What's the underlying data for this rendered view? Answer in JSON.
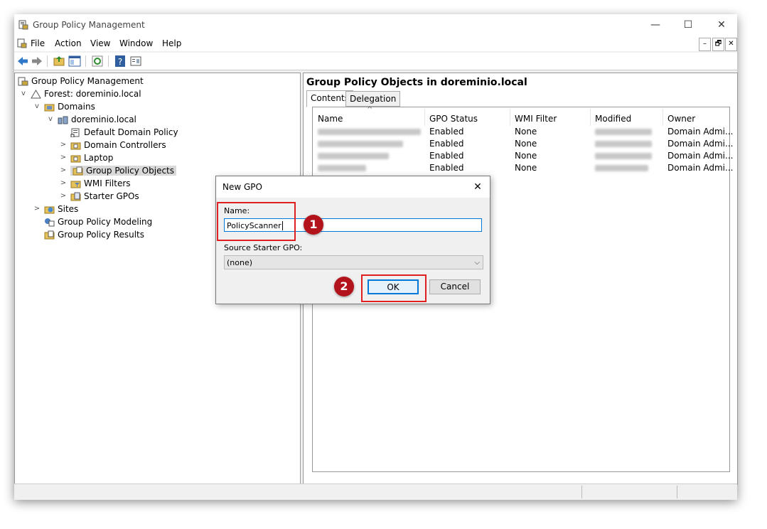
{
  "window": {
    "title": "Group Policy Management",
    "controls": [
      "—",
      "☐",
      "✕"
    ]
  },
  "menu": {
    "items": [
      "File",
      "Action",
      "View",
      "Window",
      "Help"
    ],
    "mdi": [
      "–",
      "🗗",
      "✕"
    ]
  },
  "toolbar": {
    "icons": [
      "back-icon",
      "forward-icon",
      "up-folder-icon",
      "show-hide-tree-icon",
      "refresh-icon",
      "help-icon",
      "properties-icon"
    ]
  },
  "tree": {
    "root": "Group Policy Management",
    "forest": "Forest: doreminio.local",
    "domains": "Domains",
    "domain": "doreminio.local",
    "default_policy": "Default Domain Policy",
    "domain_controllers": "Domain Controllers",
    "laptop": "Laptop",
    "gpo": "Group Policy Objects",
    "wmi": "WMI Filters",
    "starter": "Starter GPOs",
    "sites": "Sites",
    "modeling": "Group Policy Modeling",
    "results": "Group Policy Results"
  },
  "right": {
    "heading": "Group Policy Objects in doreminio.local",
    "tabs": [
      "Contents",
      "Delegation"
    ],
    "columns": [
      "Name",
      "GPO Status",
      "WMI Filter",
      "Modified",
      "Owner"
    ],
    "rows": [
      {
        "status": "Enabled",
        "wmi": "None",
        "owner": "Domain Admi..."
      },
      {
        "status": "Enabled",
        "wmi": "None",
        "owner": "Domain Admi..."
      },
      {
        "status": "Enabled",
        "wmi": "None",
        "owner": "Domain Admi..."
      },
      {
        "status": "Enabled",
        "wmi": "None",
        "owner": "Domain Admi..."
      }
    ]
  },
  "dialog": {
    "title": "New GPO",
    "name_label": "Name:",
    "name_value": "PolicyScanner",
    "source_label": "Source Starter GPO:",
    "source_value": "(none)",
    "ok": "OK",
    "cancel": "Cancel",
    "close": "✕"
  },
  "annotations": {
    "step1": "1",
    "step2": "2",
    "color": "#b3141c"
  }
}
